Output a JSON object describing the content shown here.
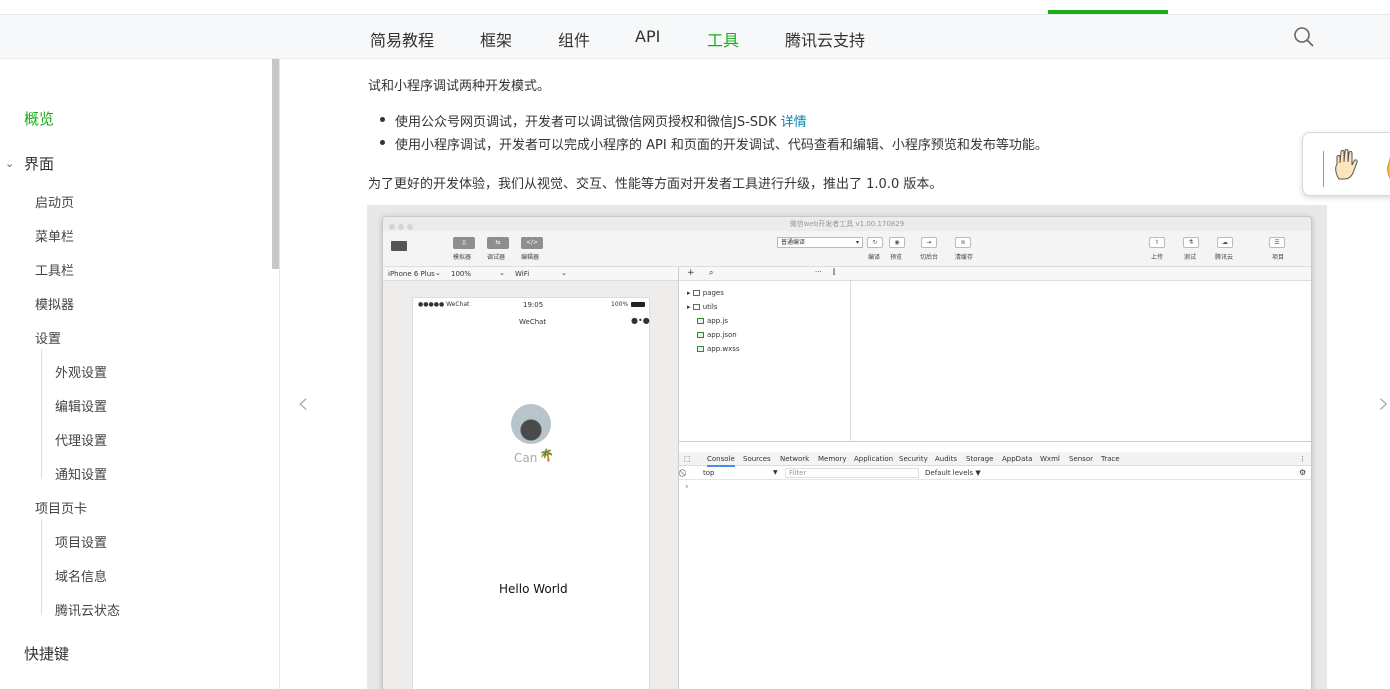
{
  "topnav": {
    "items": [
      "简易教程",
      "框架",
      "组件",
      "API",
      "工具",
      "腾讯云支持"
    ],
    "active": "工具"
  },
  "sidebar": {
    "overview": "概览",
    "ui_section": "界面",
    "ui_items": [
      "启动页",
      "菜单栏",
      "工具栏",
      "模拟器",
      "设置"
    ],
    "settings_children": [
      "外观设置",
      "编辑设置",
      "代理设置",
      "通知设置"
    ],
    "project_tab": "项目页卡",
    "project_children": [
      "项目设置",
      "域名信息",
      "腾讯云状态"
    ],
    "shortcuts": "快捷键"
  },
  "content": {
    "line1": "试和小程序调试两种开发模式。",
    "bullet1": "使用公众号网页调试，开发者可以调试微信网页授权和微信JS-SDK ",
    "bullet1_link": "详情",
    "bullet2": "使用小程序调试，开发者可以完成小程序的 API 和页面的开发调试、代码查看和编辑、小程序预览和发布等功能。",
    "line2": "为了更好的开发体验，我们从视觉、交互、性能等方面对开发者工具进行升级，推出了 1.0.0 版本。"
  },
  "devtools": {
    "title": "微信web开发者工具 v1.00.170829",
    "left_buttons": [
      "模拟器",
      "调试器",
      "编辑器"
    ],
    "compile_mode": "普通编译",
    "mid_buttons": [
      "编译",
      "预览",
      "切后台",
      "清缓存"
    ],
    "right_buttons": [
      "上传",
      "测试",
      "腾讯云",
      "项目"
    ],
    "device": "iPhone 6 Plus",
    "zoom": "100%",
    "network": "WiFi",
    "phone_status": {
      "carrier": "●●●●● WeChat",
      "time": "19:05",
      "battery": "100%"
    },
    "phone_title": "WeChat",
    "user_name": "Can",
    "hello": "Hello World",
    "files": [
      "pages",
      "utils",
      "app.js",
      "app.json",
      "app.wxss"
    ],
    "console_tabs": [
      "Console",
      "Sources",
      "Network",
      "Memory",
      "Application",
      "Security",
      "Audits",
      "Storage",
      "AppData",
      "Wxml",
      "Sensor",
      "Trace"
    ],
    "context": "top",
    "filter_placeholder": "Filter",
    "levels": "Default levels ▼",
    "prompt": "›"
  },
  "icons": {
    "search": "search-icon",
    "prev": "chevron-left-icon",
    "next": "chevron-right-icon",
    "hand": "hand-icon"
  },
  "colors": {
    "accent": "#1aad19",
    "link": "#0086b3"
  }
}
